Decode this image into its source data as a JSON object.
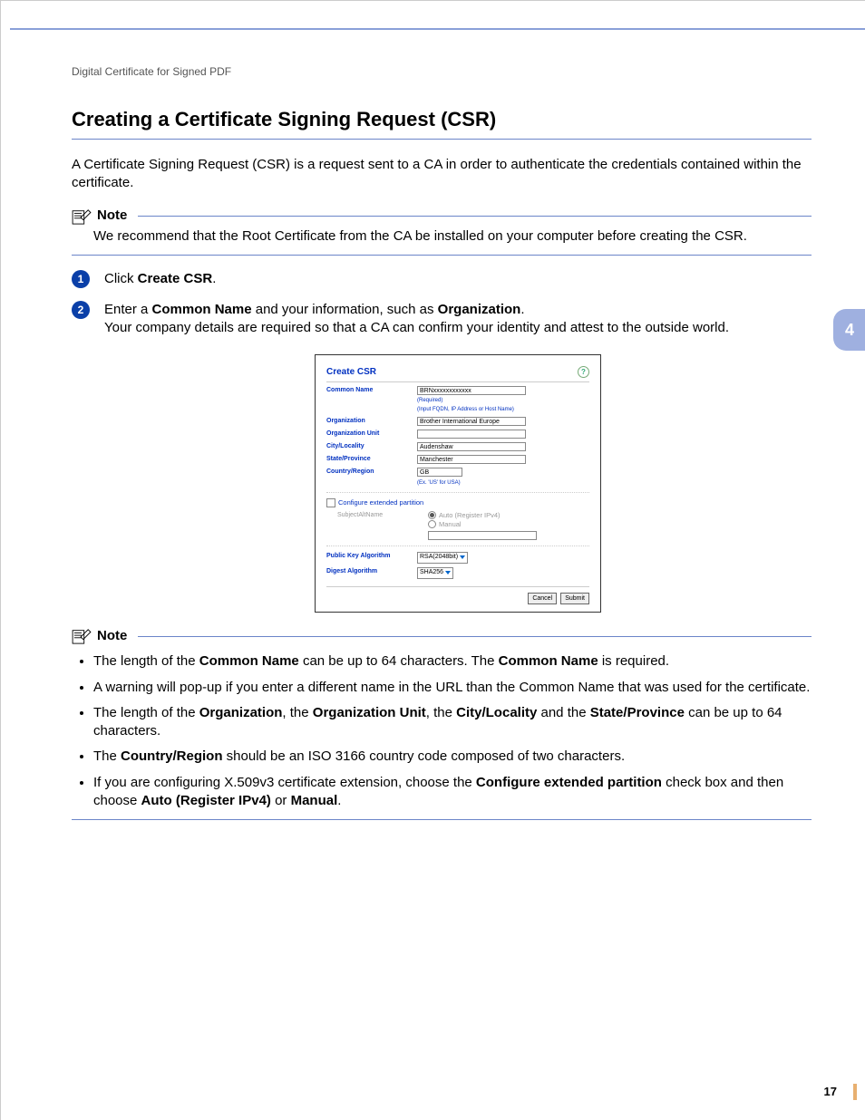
{
  "breadcrumb": "Digital Certificate for Signed PDF",
  "page_title": "Creating a Certificate Signing Request (CSR)",
  "intro": "A Certificate Signing Request (CSR) is a request sent to a CA in order to authenticate the credentials contained within the certificate.",
  "note1_label": "Note",
  "note1_body": "We recommend that the Root Certificate from the CA be installed on your computer before creating the CSR.",
  "step1_pre": "Click ",
  "step1_bold": "Create CSR",
  "step1_post": ".",
  "step2_pre": "Enter a ",
  "step2_b1": "Common Name",
  "step2_mid": " and your information, such as ",
  "step2_b2": "Organization",
  "step2_post": ".",
  "step2_line2": "Your company details are required so that a CA can confirm your identity and attest to the outside world.",
  "embedded": {
    "title": "Create CSR",
    "common_name_label": "Common Name",
    "common_name_value": "BRNxxxxxxxxxxxx",
    "common_name_hint1": "(Required)",
    "common_name_hint2": "(Input FQDN, IP Address or Host Name)",
    "organization_label": "Organization",
    "organization_value": "Brother International Europe",
    "org_unit_label": "Organization Unit",
    "org_unit_value": "",
    "city_label": "City/Locality",
    "city_value": "Audenshaw",
    "state_label": "State/Province",
    "state_value": "Manchester",
    "country_label": "Country/Region",
    "country_value": "GB",
    "country_hint": "(Ex. 'US' for USA)",
    "ext_label": "Configure extended partition",
    "san_label": "SubjectAltName",
    "san_auto": "Auto (Register IPv4)",
    "san_manual": "Manual",
    "pka_label": "Public Key Algorithm",
    "pka_value": "RSA(2048bit)",
    "digest_label": "Digest Algorithm",
    "digest_value": "SHA256",
    "cancel": "Cancel",
    "submit": "Submit"
  },
  "note2_label": "Note",
  "bullets": {
    "b1_a": "The length of the ",
    "b1_b": "Common Name",
    "b1_c": " can be up to 64 characters. The ",
    "b1_d": "Common Name",
    "b1_e": " is required.",
    "b2": "A warning will pop-up if you enter a different name in the URL than the Common Name that was used for the certificate.",
    "b3_a": "The length of the ",
    "b3_b": "Organization",
    "b3_c": ", the ",
    "b3_d": "Organization Unit",
    "b3_e": ", the ",
    "b3_f": "City/Locality",
    "b3_g": " and the ",
    "b3_h": "State/Province",
    "b3_i": " can be up to 64 characters.",
    "b4_a": "The ",
    "b4_b": "Country/Region",
    "b4_c": " should be an ISO 3166 country code composed of two characters.",
    "b5_a": "If you are configuring X.509v3 certificate extension, choose the ",
    "b5_b": "Configure extended partition",
    "b5_c": " check box and then choose ",
    "b5_d": "Auto (Register IPv4)",
    "b5_e": " or ",
    "b5_f": "Manual",
    "b5_g": "."
  },
  "chapter_num": "4",
  "page_num": "17"
}
